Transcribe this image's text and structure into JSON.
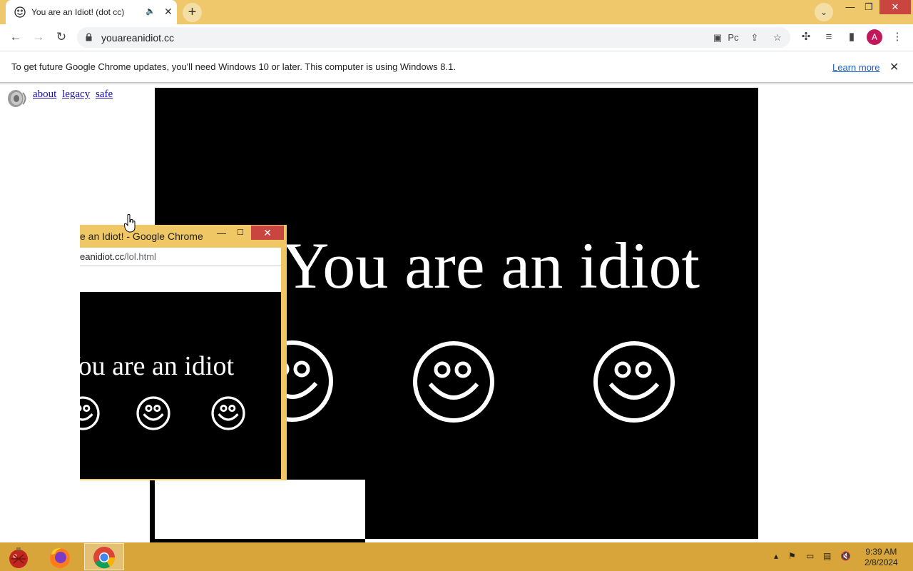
{
  "browser": {
    "tab_title": "You are an Idiot! (dot cc)",
    "url": "youareanidiot.cc",
    "omnibox_translate_label": "Pc",
    "profile_initial": "A"
  },
  "infobar": {
    "message": "To get future Google Chrome updates, you'll need Windows 10 or later. This computer is using Windows 8.1.",
    "link": "Learn more"
  },
  "page": {
    "links": [
      "about",
      "legacy",
      "safe"
    ],
    "banner_text": "You are an idiot"
  },
  "popup": {
    "title": "e an Idiot! - Google Chrome",
    "url_host": "eanidiot.cc",
    "url_path": "/lol.html",
    "banner_text": "You are an idiot"
  },
  "taskbar": {
    "apps": [
      "christmas-ornament-app",
      "firefox",
      "chrome"
    ],
    "time": "9:39 AM",
    "date": "2/8/2024"
  }
}
